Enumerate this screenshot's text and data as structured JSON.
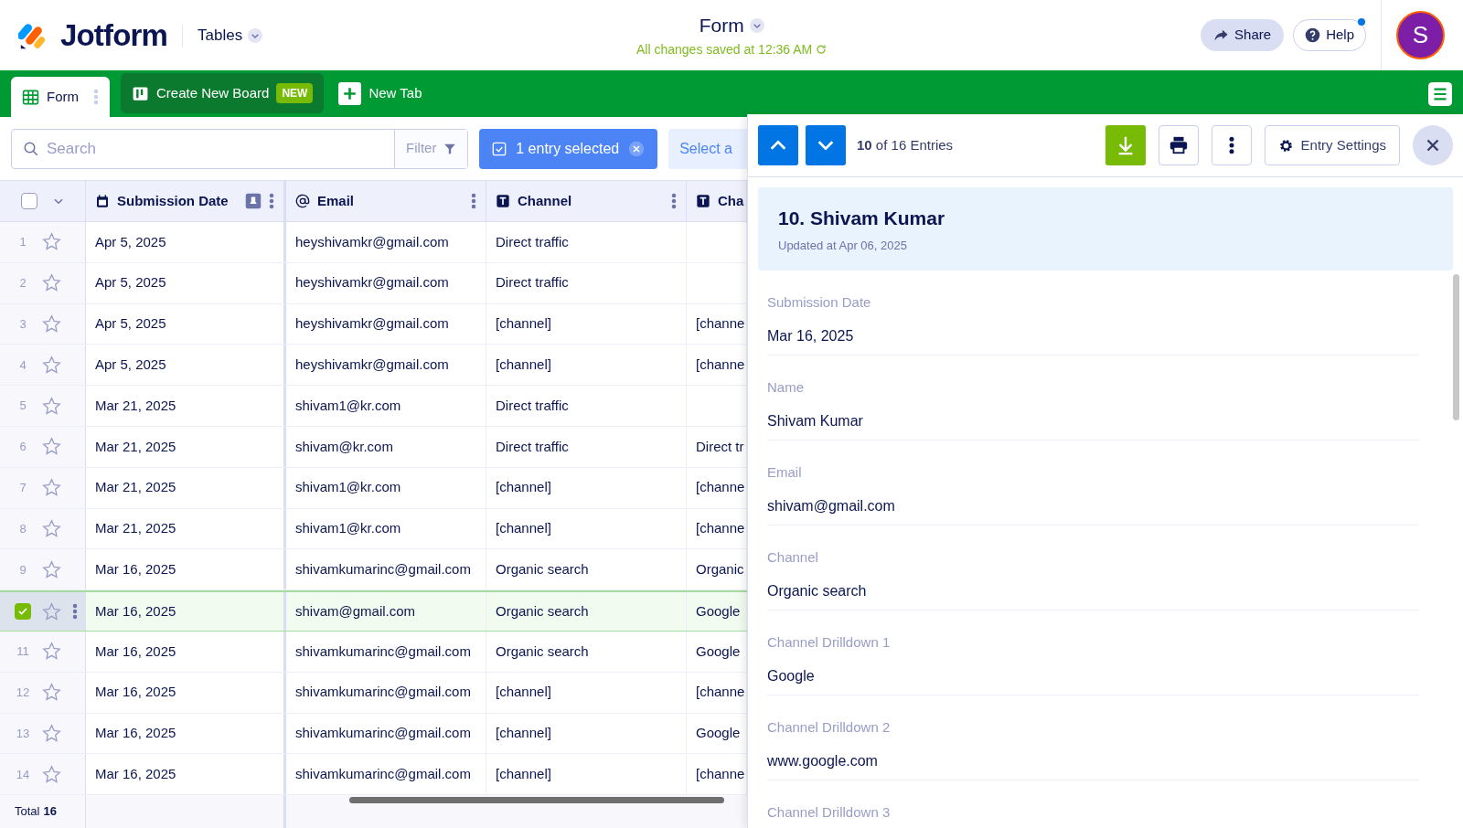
{
  "header": {
    "brand": "Jotform",
    "product": "Tables",
    "form_title": "Form",
    "save_status": "All changes saved at 12:36 AM",
    "share": "Share",
    "help": "Help",
    "help_notification": true,
    "avatar_initial": "S"
  },
  "tabs": [
    {
      "label": "Form",
      "selected": true,
      "kind": "table"
    },
    {
      "label": "Create New Board",
      "badge": "NEW",
      "selected": false,
      "kind": "board"
    },
    {
      "label": "New Tab",
      "selected": false,
      "kind": "add"
    }
  ],
  "toolbar": {
    "search_placeholder": "Search",
    "filter": "Filter",
    "selection": "1 entry selected",
    "select_all": "Select a"
  },
  "table": {
    "select_all_checked": false,
    "columns": [
      {
        "label": "Submission Date",
        "kind": "date"
      },
      {
        "label": "Email",
        "kind": "email"
      },
      {
        "label": "Channel",
        "kind": "text"
      },
      {
        "label": "Cha",
        "kind": "text"
      }
    ],
    "rows": [
      {
        "number": "1",
        "selected": false,
        "starred": false,
        "cells": [
          "Apr 5, 2025",
          "heyshivamkr@gmail.com",
          "Direct traffic"
        ]
      },
      {
        "number": "2",
        "selected": false,
        "starred": false,
        "cells": [
          "Apr 5, 2025",
          "heyshivamkr@gmail.com",
          "Direct traffic"
        ]
      },
      {
        "number": "3",
        "selected": false,
        "starred": false,
        "cells": [
          "Apr 5, 2025",
          "heyshivamkr@gmail.com",
          "[channel]",
          "[channe"
        ]
      },
      {
        "number": "4",
        "selected": false,
        "starred": false,
        "cells": [
          "Apr 5, 2025",
          "heyshivamkr@gmail.com",
          "[channel]",
          "[channe"
        ]
      },
      {
        "number": "5",
        "selected": false,
        "starred": false,
        "cells": [
          "Mar 21, 2025",
          "shivam1@kr.com",
          "Direct traffic"
        ]
      },
      {
        "number": "6",
        "selected": false,
        "starred": false,
        "cells": [
          "Mar 21, 2025",
          "shivam@kr.com",
          "Direct traffic",
          "Direct tr"
        ]
      },
      {
        "number": "7",
        "selected": false,
        "starred": false,
        "cells": [
          "Mar 21, 2025",
          "shivam1@kr.com",
          "[channel]",
          "[channe"
        ]
      },
      {
        "number": "8",
        "selected": false,
        "starred": false,
        "cells": [
          "Mar 21, 2025",
          "shivam1@kr.com",
          "[channel]",
          "[channe"
        ]
      },
      {
        "number": "9",
        "selected": false,
        "starred": false,
        "cells": [
          "Mar 16, 2025",
          "shivamkumarinc@gmail.com",
          "Organic search",
          "Organic"
        ]
      },
      {
        "selected": true,
        "starred": false,
        "cells": [
          "Mar 16, 2025",
          "shivam@gmail.com",
          "Organic search",
          "Google"
        ]
      },
      {
        "number": "11",
        "selected": false,
        "starred": false,
        "cells": [
          "Mar 16, 2025",
          "shivamkumarinc@gmail.com",
          "Organic search",
          "Google"
        ]
      },
      {
        "number": "12",
        "selected": false,
        "starred": false,
        "cells": [
          "Mar 16, 2025",
          "shivamkumarinc@gmail.com",
          "[channel]",
          "[channe"
        ]
      },
      {
        "number": "13",
        "selected": false,
        "starred": false,
        "cells": [
          "Mar 16, 2025",
          "shivamkumarinc@gmail.com",
          "[channel]",
          "Google"
        ]
      },
      {
        "number": "14",
        "selected": false,
        "starred": false,
        "cells": [
          "Mar 16, 2025",
          "shivamkumarinc@gmail.com",
          "[channel]",
          "[channe"
        ]
      }
    ],
    "total_label": "Total",
    "total_value": "16"
  },
  "panel": {
    "counter_current": "10",
    "counter_rest": "of 16 Entries",
    "entry_settings": "Entry Settings",
    "title": "10. Shivam Kumar",
    "updated": "Updated at Apr 06, 2025",
    "fields": [
      {
        "label": "Submission Date",
        "value": "Mar 16, 2025"
      },
      {
        "label": "Name",
        "value": "Shivam Kumar"
      },
      {
        "label": "Email",
        "value": "shivam@gmail.com"
      },
      {
        "label": "Channel",
        "value": "Organic search"
      },
      {
        "label": "Channel Drilldown 1",
        "value": "Google"
      },
      {
        "label": "Channel Drilldown 2",
        "value": "www.google.com"
      },
      {
        "label": "Channel Drilldown 3"
      }
    ]
  }
}
